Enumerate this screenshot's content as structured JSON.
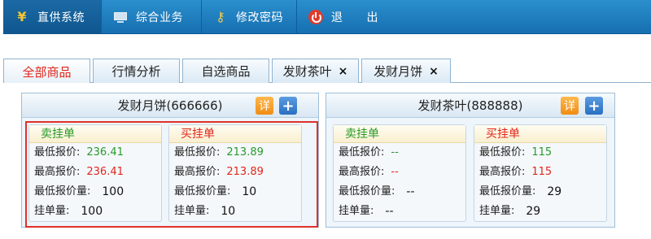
{
  "nav": [
    {
      "label": "直供系统",
      "icon": "yen-icon"
    },
    {
      "label": "综合业务",
      "icon": "monitor-icon"
    },
    {
      "label": "修改密码",
      "icon": "key-icon"
    },
    {
      "label": "退　　出",
      "icon": "power-icon"
    }
  ],
  "tabs": [
    {
      "label": "全部商品"
    },
    {
      "label": "行情分析"
    },
    {
      "label": "自选商品"
    },
    {
      "label": "发财茶叶",
      "close": "×"
    },
    {
      "label": "发财月饼",
      "close": "×"
    }
  ],
  "buttons": {
    "detail": "详",
    "add": "+"
  },
  "panels": [
    {
      "title": "发财月饼(666666)",
      "sell": {
        "title": "卖挂单",
        "rows": [
          {
            "key": "最低报价:",
            "value": "236.41"
          },
          {
            "key": "最高报价:",
            "value": "236.41"
          },
          {
            "key": "最低报价量:",
            "value": "100"
          },
          {
            "key": "挂单量:",
            "value": "100"
          }
        ]
      },
      "buy": {
        "title": "买挂单",
        "rows": [
          {
            "key": "最低报价:",
            "value": "213.89"
          },
          {
            "key": "最高报价:",
            "value": "213.89"
          },
          {
            "key": "最低报价量:",
            "value": "10"
          },
          {
            "key": "挂单量:",
            "value": "10"
          }
        ]
      }
    },
    {
      "title": "发财茶叶(888888)",
      "sell": {
        "title": "卖挂单",
        "rows": [
          {
            "key": "最低报价:",
            "value": "--"
          },
          {
            "key": "最高报价:",
            "value": "--"
          },
          {
            "key": "最低报价量:",
            "value": "--"
          },
          {
            "key": "挂单量:",
            "value": "--"
          }
        ]
      },
      "buy": {
        "title": "买挂单",
        "rows": [
          {
            "key": "最低报价:",
            "value": "115"
          },
          {
            "key": "最高报价:",
            "value": "115"
          },
          {
            "key": "最低报价量:",
            "value": "29"
          },
          {
            "key": "挂单量:",
            "value": "29"
          }
        ]
      }
    }
  ],
  "colors": {
    "sell": "#2a9a2a",
    "buy": "#e1261c",
    "highlight": "#e0302a",
    "nav": "#1a7abf"
  }
}
